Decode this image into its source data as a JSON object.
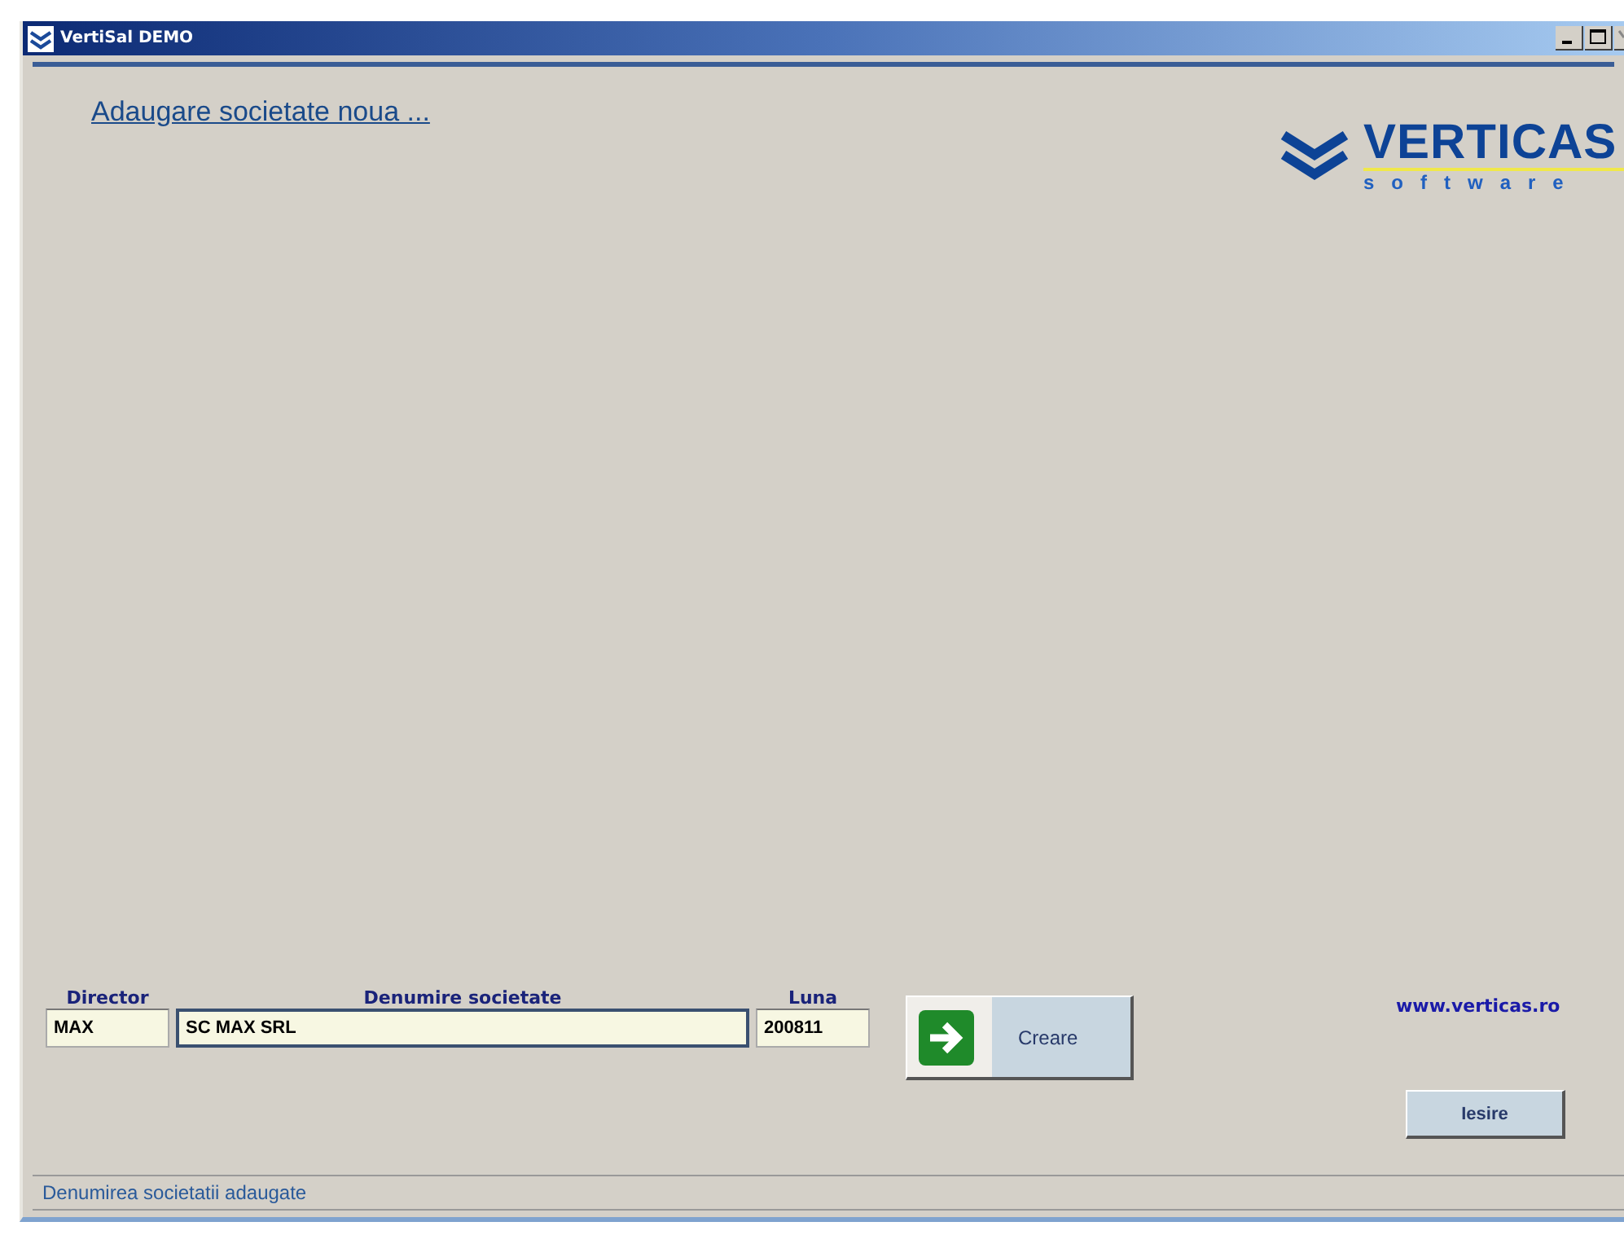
{
  "window": {
    "title": "VertiSal DEMO"
  },
  "heading": "Adaugare societate noua ...",
  "logo": {
    "name": "VERTICAS",
    "tagline": "software"
  },
  "fields": [
    {
      "label": "Director",
      "value": "MAX",
      "focused": false
    },
    {
      "label": "Denumire societate",
      "value": "SC MAX SRL",
      "focused": true
    },
    {
      "label": "Luna",
      "value": "200811",
      "focused": false
    }
  ],
  "create_button": "Creare",
  "website": "www.verticas.ro",
  "exit_button": "Iesire",
  "status_bar": "Denumirea societatii adaugate"
}
